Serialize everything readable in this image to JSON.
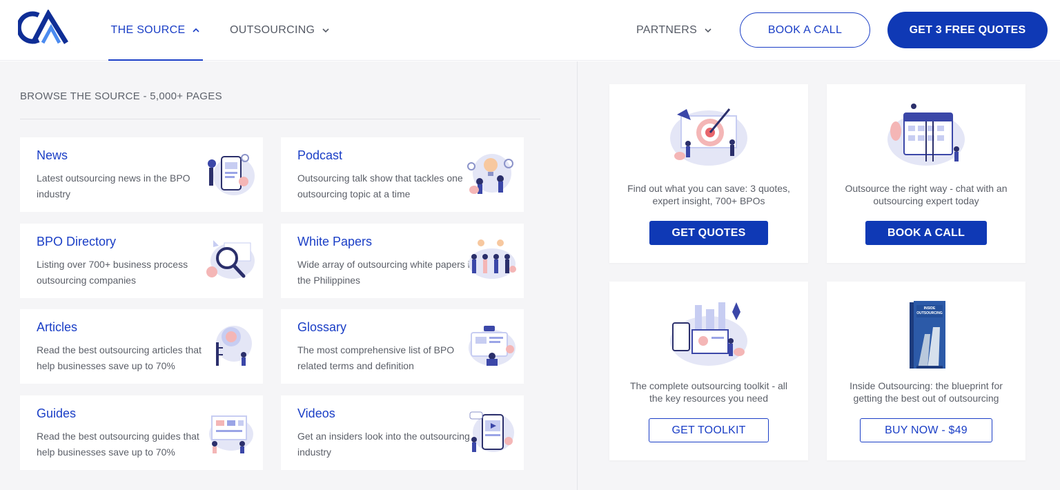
{
  "header": {
    "nav": [
      {
        "label": "THE SOURCE",
        "active": true,
        "chevron": "chevron-up"
      },
      {
        "label": "OUTSOURCING",
        "active": false,
        "chevron": "chevron-down"
      },
      {
        "label": "PARTNERS",
        "active": false,
        "chevron": "chevron-down"
      }
    ],
    "book_call_label": "BOOK A CALL",
    "quotes_label": "GET 3 FREE QUOTES"
  },
  "browse": {
    "title": "BROWSE THE SOURCE - 5,000+ PAGES",
    "cards": [
      {
        "title": "News",
        "desc": "Latest outsourcing news in the BPO industry",
        "icon": "news-illustration-icon"
      },
      {
        "title": "Podcast",
        "desc": "Outsourcing talk show that tackles one outsourcing topic at a time",
        "icon": "podcast-illustration-icon"
      },
      {
        "title": "BPO Directory",
        "desc": "Listing over 700+ business process outsourcing companies",
        "icon": "magnifier-illustration-icon"
      },
      {
        "title": "White Papers",
        "desc": "Wide array of outsourcing white papers in the Philippines",
        "icon": "team-illustration-icon"
      },
      {
        "title": "Articles",
        "desc": "Read the best outsourcing articles that help businesses save up to 70%",
        "icon": "articles-illustration-icon"
      },
      {
        "title": "Glossary",
        "desc": "The most comprehensive list of BPO related terms and definition",
        "icon": "glossary-illustration-icon"
      },
      {
        "title": "Guides",
        "desc": "Read the best outsourcing guides that help businesses save up to 70%",
        "icon": "guides-illustration-icon"
      },
      {
        "title": "Videos",
        "desc": "Get an insiders look into the outsourcing industry",
        "icon": "videos-illustration-icon"
      }
    ]
  },
  "promos": [
    {
      "text": "Find out what you can save: 3 quotes, expert insight, 700+ BPOs",
      "button": "GET QUOTES",
      "style": "solid",
      "icon": "target-illustration-icon"
    },
    {
      "text": "Outsource the right way - chat with an outsourcing expert today",
      "button": "BOOK A CALL",
      "style": "solid",
      "icon": "calendar-illustration-icon"
    },
    {
      "text": "The complete outsourcing toolkit - all the key resources you need",
      "button": "GET TOOLKIT",
      "style": "outline",
      "icon": "toolkit-illustration-icon"
    },
    {
      "text": "Inside Outsourcing: the blueprint for getting the best out of outsourcing",
      "button": "BUY NOW - $49",
      "style": "outline",
      "icon": "book-cover-icon",
      "book_title": "INSIDE OUTSOURCING"
    }
  ],
  "colors": {
    "brand_blue": "#0f39b5",
    "link_blue": "#1a3ec6",
    "panel_bg": "#f5f5f7",
    "illustration_pink": "#f4b6b6",
    "illustration_lilac": "#dfe2f5"
  }
}
